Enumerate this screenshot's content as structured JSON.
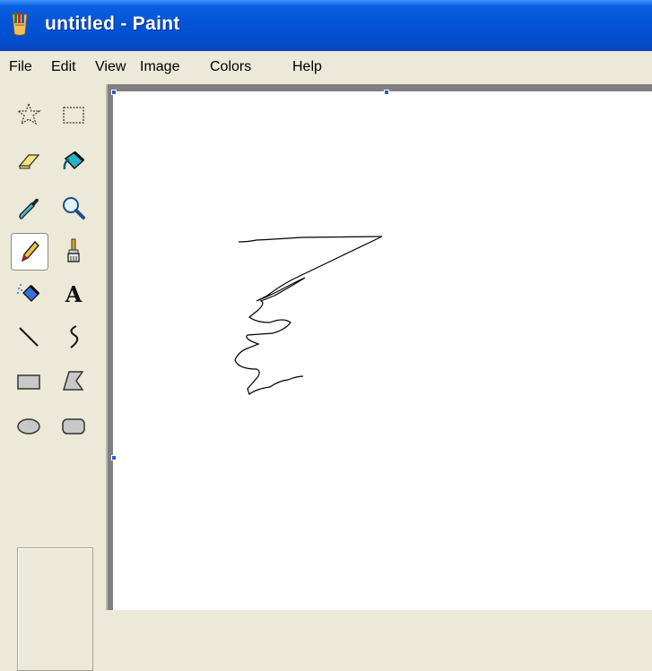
{
  "window": {
    "title": "untitled - Paint",
    "app_icon": "paint-app-icon"
  },
  "menu": [
    "File",
    "Edit",
    "View",
    "Image",
    "Colors",
    "Help"
  ],
  "tools": [
    {
      "name": "free-form-select-icon",
      "label": "Free-Form Select"
    },
    {
      "name": "select-icon",
      "label": "Select"
    },
    {
      "name": "eraser-icon",
      "label": "Eraser"
    },
    {
      "name": "fill-bucket-icon",
      "label": "Fill With Color"
    },
    {
      "name": "pick-color-icon",
      "label": "Pick Color"
    },
    {
      "name": "magnifier-icon",
      "label": "Magnifier"
    },
    {
      "name": "pencil-icon",
      "label": "Pencil",
      "selected": true
    },
    {
      "name": "brush-icon",
      "label": "Brush"
    },
    {
      "name": "airbrush-icon",
      "label": "Airbrush"
    },
    {
      "name": "text-icon",
      "label": "Text",
      "glyph": "A"
    },
    {
      "name": "line-icon",
      "label": "Line"
    },
    {
      "name": "curve-icon",
      "label": "Curve"
    },
    {
      "name": "rectangle-icon",
      "label": "Rectangle"
    },
    {
      "name": "polygon-icon",
      "label": "Polygon"
    },
    {
      "name": "ellipse-icon",
      "label": "Ellipse"
    },
    {
      "name": "rounded-rectangle-icon",
      "label": "Rounded Rectangle"
    }
  ],
  "colors": {
    "titlebar": "#0354d6",
    "face": "#ece9d8",
    "canvas": "#ffffff",
    "workspace": "#808080",
    "stroke": "#000000"
  }
}
